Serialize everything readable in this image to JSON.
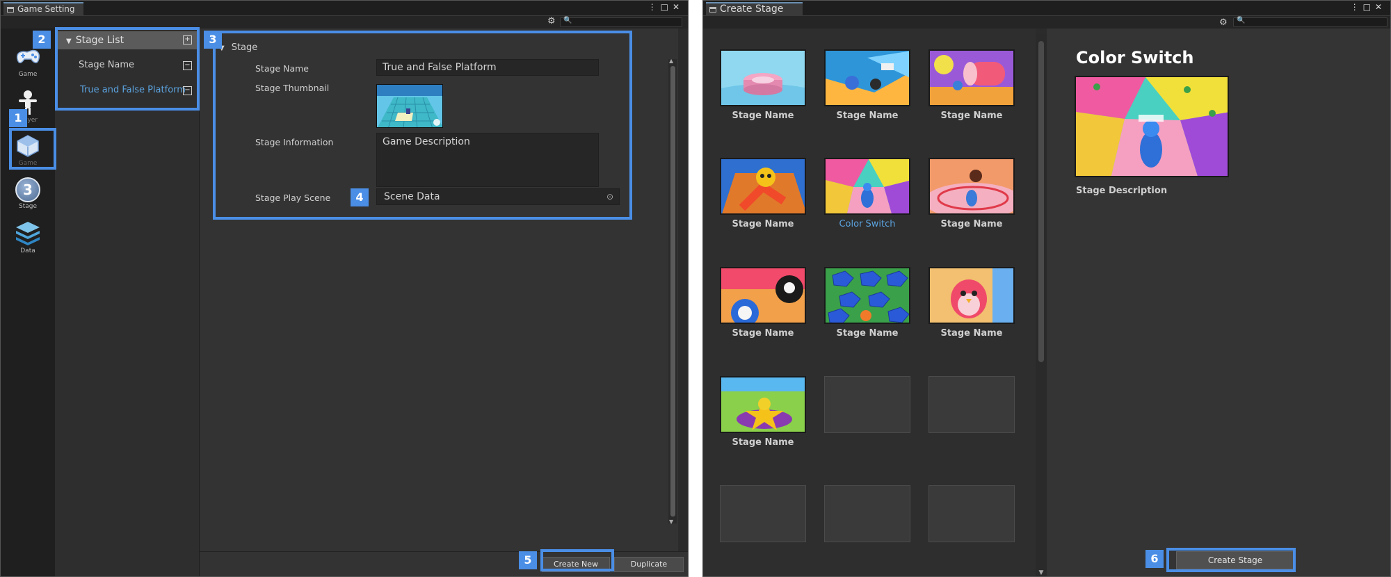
{
  "left_window": {
    "tab_title": "Game Setting",
    "rail": [
      {
        "label": "Game",
        "icon": "game-controller-icon"
      },
      {
        "label": "Player",
        "icon": "player-figure-icon"
      },
      {
        "label": "Game",
        "icon": "gamemode-cube-icon"
      },
      {
        "label": "Stage",
        "icon": "stage-number-icon",
        "glyph": "3"
      },
      {
        "label": "Data",
        "icon": "data-stack-icon"
      }
    ],
    "stage_list": {
      "header": "Stage List",
      "items": [
        "Stage Name",
        "True and False Platform"
      ]
    },
    "section_title": "Stage",
    "fields": {
      "stage_name_label": "Stage Name",
      "stage_name_value": "True and False Platform",
      "thumbnail_label": "Stage Thumbnail",
      "info_label": "Stage Information",
      "info_value": "Game Description",
      "play_scene_label": "Stage Play Scene",
      "play_scene_value": "Scene Data"
    },
    "buttons": {
      "create_new": "Create New",
      "duplicate": "Duplicate"
    }
  },
  "right_window": {
    "tab_title": "Create Stage",
    "stages": [
      {
        "name": "Stage Name",
        "selected": false
      },
      {
        "name": "Stage Name",
        "selected": false
      },
      {
        "name": "Stage Name",
        "selected": false
      },
      {
        "name": "Stage Name",
        "selected": false
      },
      {
        "name": "Color Switch",
        "selected": true
      },
      {
        "name": "Stage Name",
        "selected": false
      },
      {
        "name": "Stage Name",
        "selected": false
      },
      {
        "name": "Stage Name",
        "selected": false
      },
      {
        "name": "Stage Name",
        "selected": false
      },
      {
        "name": "Stage Name",
        "selected": false
      }
    ],
    "preview": {
      "title": "Color Switch",
      "description": "Stage Description"
    },
    "create_button": "Create Stage"
  },
  "annotations": [
    "1",
    "2",
    "3",
    "4",
    "5",
    "6"
  ],
  "colors": {
    "highlight": "#4a8ee6",
    "selected_text": "#5ba3e0",
    "panel_bg": "#2b2b2b"
  }
}
